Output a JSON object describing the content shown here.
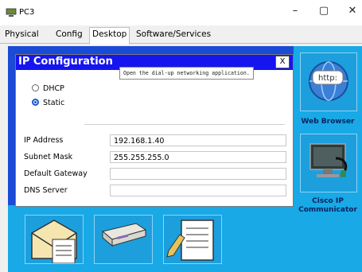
{
  "window": {
    "title": "PC3"
  },
  "window_controls": {
    "minimize": "–",
    "maximize": "▢",
    "close": "✕"
  },
  "tabs": [
    {
      "label": "Physical"
    },
    {
      "label": "Config"
    },
    {
      "label": "Desktop"
    },
    {
      "label": "Software/Services"
    }
  ],
  "dialog": {
    "title": "IP Configuration",
    "close": "X",
    "tooltip": "Open the dial-up networking application.",
    "radios": [
      {
        "label": "DHCP"
      },
      {
        "label": "Static"
      }
    ],
    "fields": [
      {
        "label": "IP Address",
        "value": "192.168.1.40"
      },
      {
        "label": "Subnet Mask",
        "value": "255.255.255.0"
      },
      {
        "label": "Default Gateway",
        "value": ""
      },
      {
        "label": "DNS Server",
        "value": ""
      }
    ]
  },
  "apps": {
    "web_browser": "Web Browser",
    "cisco_ip_communicator": "Cisco IP\nCommunicator"
  }
}
